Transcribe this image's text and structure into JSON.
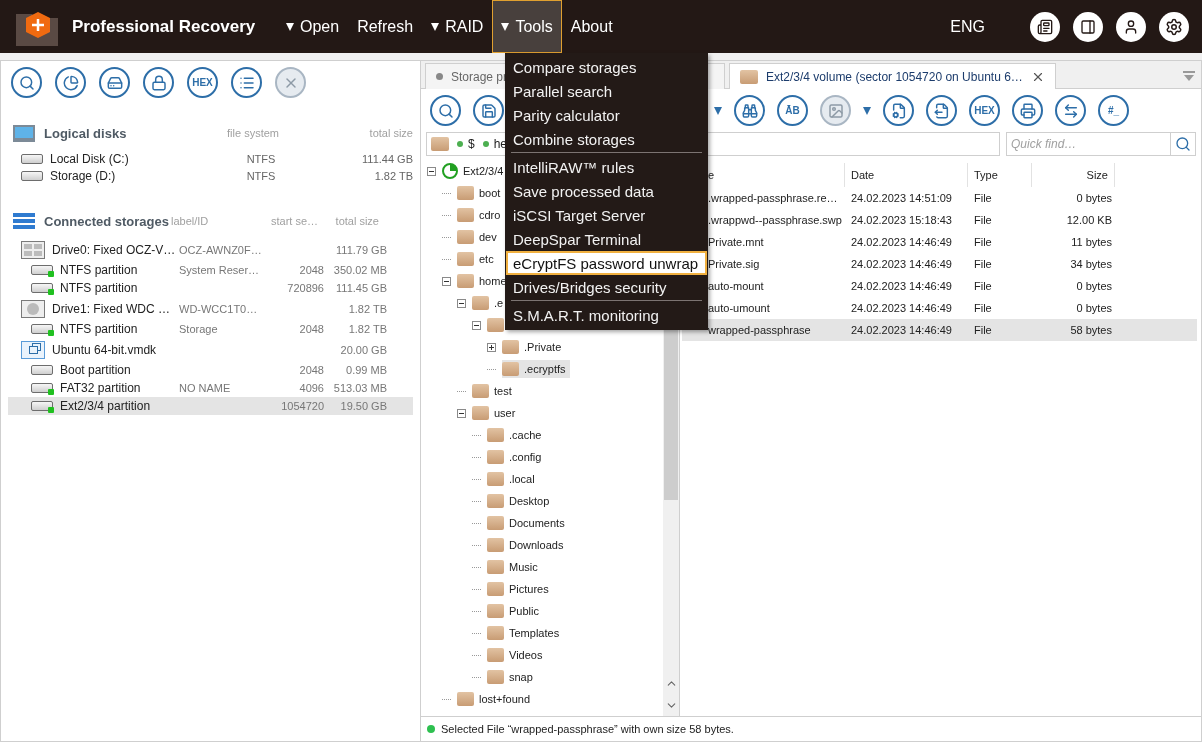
{
  "app": {
    "title": "Professional Recovery",
    "language": "ENG",
    "menu": [
      {
        "label": "Open",
        "dropdown": true,
        "selected": false
      },
      {
        "label": "Refresh",
        "dropdown": false,
        "selected": false
      },
      {
        "label": "RAID",
        "dropdown": true,
        "selected": false
      },
      {
        "label": "Tools",
        "dropdown": true,
        "selected": true
      },
      {
        "label": "About",
        "dropdown": false,
        "selected": false
      }
    ],
    "actions": [
      {
        "kind": "log"
      },
      {
        "kind": "panel"
      },
      {
        "kind": "user"
      },
      {
        "kind": "settings"
      }
    ]
  },
  "tools_menu": {
    "groups": [
      [
        {
          "label": "Compare storages",
          "selected": false
        },
        {
          "label": "Parallel search",
          "selected": false
        },
        {
          "label": "Parity calculator",
          "selected": false
        },
        {
          "label": "Combine storages",
          "selected": false
        }
      ],
      [
        {
          "label": "IntelliRAW™ rules",
          "selected": false
        },
        {
          "label": "Save processed data",
          "selected": false
        },
        {
          "label": "iSCSI Target Server",
          "selected": false
        },
        {
          "label": "DeepSpar Terminal",
          "selected": false
        },
        {
          "label": "eCryptFS password unwrap",
          "selected": true
        },
        {
          "label": "Drives/Bridges security",
          "selected": false
        }
      ],
      [
        {
          "label": "S.M.A.R.T. monitoring",
          "selected": false
        }
      ]
    ]
  },
  "left_panel": {
    "toolbar": [
      {
        "kind": "scan",
        "disabled": false
      },
      {
        "kind": "pie",
        "disabled": false
      },
      {
        "kind": "drive",
        "disabled": false
      },
      {
        "kind": "lock",
        "disabled": false
      },
      {
        "kind": "text",
        "label": "HEX",
        "disabled": false
      },
      {
        "kind": "list",
        "disabled": false
      },
      {
        "kind": "close",
        "disabled": true
      }
    ],
    "logical_disks": {
      "title": "Logical disks",
      "columns": [
        "file system",
        "total size"
      ],
      "rows": [
        {
          "name": "Local Disk (C:)",
          "file_system": "NTFS",
          "total_size": "111.44 GB"
        },
        {
          "name": "Storage (D:)",
          "file_system": "NTFS",
          "total_size": "1.82 TB"
        }
      ]
    },
    "connected_storages": {
      "title": "Connected storages",
      "columns": [
        "label/ID",
        "start se…",
        "total size"
      ],
      "rows": [
        {
          "kind": "drive",
          "name": "Drive0: Fixed OCZ-V…",
          "label": "OCZ-AWNZ0F…",
          "total_size": "111.79 GB",
          "selected": false
        },
        {
          "kind": "partition",
          "name": "NTFS partition",
          "label": "System Reser…",
          "start": "2048",
          "total_size": "350.02 MB",
          "selected": false
        },
        {
          "kind": "partition",
          "name": "NTFS partition",
          "start": "720896",
          "total_size": "111.45 GB",
          "selected": false
        },
        {
          "kind": "hdd",
          "name": "Drive1: Fixed WDC …",
          "label": "WD-WCC1T0…",
          "total_size": "1.82 TB",
          "selected": false
        },
        {
          "kind": "partition",
          "name": "NTFS partition",
          "label": "Storage",
          "start": "2048",
          "total_size": "1.82 TB",
          "selected": false
        },
        {
          "kind": "image",
          "name": "Ubuntu 64-bit.vmdk",
          "total_size": "20.00 GB",
          "selected": false
        },
        {
          "kind": "raw_partition",
          "name": "Boot partition",
          "start": "2048",
          "total_size": "0.99 MB",
          "selected": false
        },
        {
          "kind": "partition",
          "name": "FAT32 partition",
          "label": "NO NAME",
          "start": "4096",
          "total_size": "513.03 MB",
          "selected": false
        },
        {
          "kind": "partition",
          "name": "Ext2/3/4 partition",
          "start": "1054720",
          "total_size": "19.50 GB",
          "selected": true
        }
      ]
    }
  },
  "workspace": {
    "tabs": [
      {
        "kind": "dot",
        "label": "Storage pr",
        "selected": false,
        "closable": false
      },
      {
        "kind": "folder",
        "label": "Ext2/3/4 volume (sector 1054720 on Ubuntu 6…",
        "selected": true,
        "closable": true
      }
    ],
    "toolbar_left": [
      {
        "kind": "scan"
      },
      {
        "kind": "save"
      }
    ],
    "toolbar_right": [
      {
        "kind": "caret"
      },
      {
        "kind": "binoculars"
      },
      {
        "kind": "text",
        "label": "ĀB"
      },
      {
        "kind": "preview",
        "disabled": true
      },
      {
        "kind": "caret"
      },
      {
        "kind": "export_settings"
      },
      {
        "kind": "export"
      },
      {
        "kind": "text",
        "label": "HEX"
      },
      {
        "kind": "print"
      },
      {
        "kind": "move"
      },
      {
        "kind": "text",
        "label": "#_"
      }
    ],
    "path": [
      {
        "label": "$"
      },
      {
        "label": "he"
      }
    ],
    "quick_find": {
      "placeholder": "Quick find…"
    },
    "tree": [
      {
        "kind": "volume",
        "label": "Ext2/3/4",
        "expanded": true,
        "selected": false,
        "children": [
          {
            "label": "boot",
            "selected": false
          },
          {
            "label": "cdro",
            "selected": false
          },
          {
            "label": "dev",
            "selected": false
          },
          {
            "label": "etc",
            "selected": false
          },
          {
            "label": "home",
            "expanded": true,
            "selected": false,
            "children": [
              {
                "label": ".e",
                "expanded": true,
                "selected": false,
                "children": [
                  {
                    "expanded": true,
                    "selected": false,
                    "children": [
                      {
                        "label": ".Private",
                        "expanded": false,
                        "selected": false
                      },
                      {
                        "label": ".ecryptfs",
                        "selected": true
                      }
                    ]
                  }
                ]
              },
              {
                "label": "test",
                "selected": false
              },
              {
                "label": "user",
                "expanded": true,
                "selected": false,
                "children": [
                  {
                    "label": ".cache",
                    "selected": false
                  },
                  {
                    "label": ".config",
                    "selected": false
                  },
                  {
                    "label": ".local",
                    "selected": false
                  },
                  {
                    "label": "Desktop",
                    "selected": false
                  },
                  {
                    "label": "Documents",
                    "selected": false
                  },
                  {
                    "label": "Downloads",
                    "selected": false
                  },
                  {
                    "label": "Music",
                    "selected": false
                  },
                  {
                    "label": "Pictures",
                    "selected": false
                  },
                  {
                    "label": "Public",
                    "selected": false
                  },
                  {
                    "label": "Templates",
                    "selected": false
                  },
                  {
                    "label": "Videos",
                    "selected": false
                  },
                  {
                    "label": "snap",
                    "selected": false
                  }
                ]
              }
            ]
          },
          {
            "label": "lost+found",
            "selected": false
          }
        ]
      }
    ],
    "files": {
      "columns": [
        "e",
        "Date",
        "Type",
        "Size"
      ],
      "rows": [
        {
          "name": ".wrapped-passphrase.re…",
          "date": "24.02.2023 14:51:09",
          "type": "File",
          "size": "0 bytes",
          "selected": false
        },
        {
          "name": ".wrappwd--passphrase.swp",
          "date": "24.02.2023 15:18:43",
          "type": "File",
          "size": "12.00 KB",
          "selected": false
        },
        {
          "name": "Private.mnt",
          "date": "24.02.2023 14:46:49",
          "type": "File",
          "size": "11 bytes",
          "selected": false
        },
        {
          "name": "Private.sig",
          "date": "24.02.2023 14:46:49",
          "type": "File",
          "size": "34 bytes",
          "selected": false
        },
        {
          "name": "auto-mount",
          "date": "24.02.2023 14:46:49",
          "type": "File",
          "size": "0 bytes",
          "selected": false
        },
        {
          "name": "auto-umount",
          "date": "24.02.2023 14:46:49",
          "type": "File",
          "size": "0 bytes",
          "selected": false
        },
        {
          "name": "wrapped-passphrase",
          "date": "24.02.2023 14:46:49",
          "type": "File",
          "size": "58 bytes",
          "selected": true
        }
      ]
    },
    "status": "Selected File “wrapped-passphrase” with own size 58 bytes."
  }
}
